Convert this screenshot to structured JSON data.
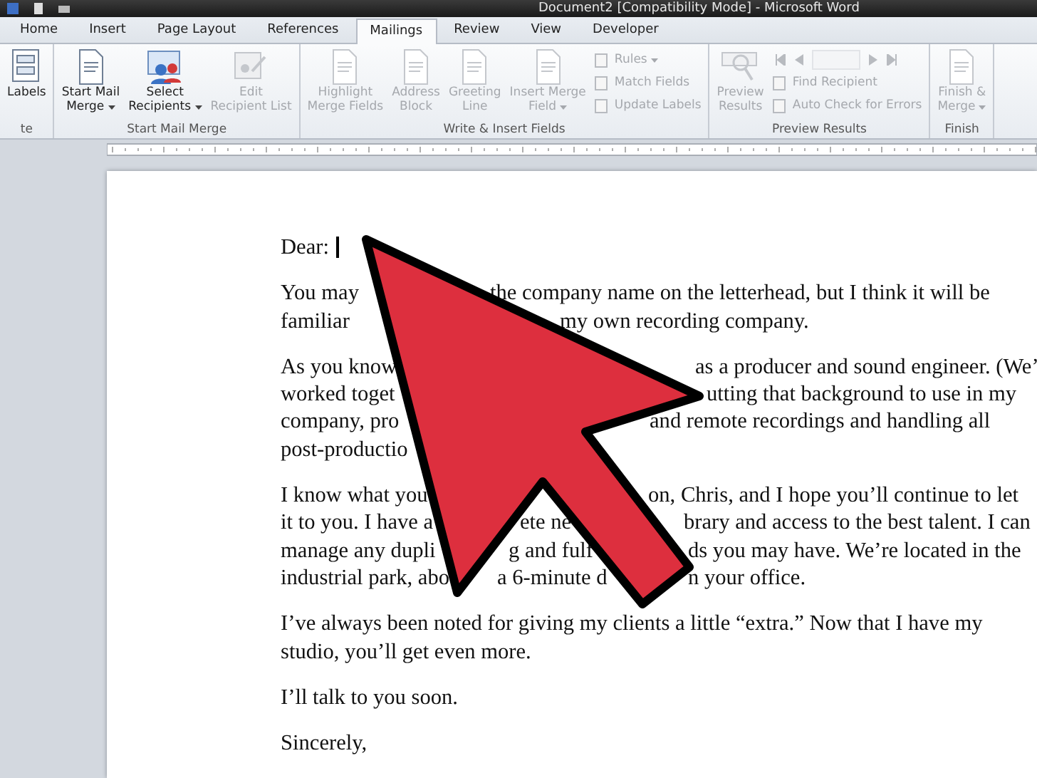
{
  "window": {
    "title": "Document2 [Compatibility Mode]  -  Microsoft Word"
  },
  "tabs": [
    {
      "label": "Home",
      "selected": false
    },
    {
      "label": "Insert",
      "selected": false
    },
    {
      "label": "Page Layout",
      "selected": false
    },
    {
      "label": "References",
      "selected": false
    },
    {
      "label": "Mailings",
      "selected": true
    },
    {
      "label": "Review",
      "selected": false
    },
    {
      "label": "View",
      "selected": false
    },
    {
      "label": "Developer",
      "selected": false
    }
  ],
  "ribbon": {
    "groups": [
      {
        "label": "te",
        "items": [
          {
            "kind": "large",
            "lines": [
              "Labels"
            ],
            "dropdown": false,
            "disabled": false
          }
        ]
      },
      {
        "label": "Start Mail Merge",
        "items": [
          {
            "kind": "large",
            "lines": [
              "Start Mail",
              "Merge"
            ],
            "dropdown": true,
            "disabled": false
          },
          {
            "kind": "large",
            "lines": [
              "Select",
              "Recipients"
            ],
            "dropdown": true,
            "disabled": false
          },
          {
            "kind": "large",
            "lines": [
              "Edit",
              "Recipient List"
            ],
            "dropdown": false,
            "disabled": true
          }
        ]
      },
      {
        "label": "Write & Insert Fields",
        "items": [
          {
            "kind": "large",
            "lines": [
              "Highlight",
              "Merge Fields"
            ],
            "dropdown": false,
            "disabled": true
          },
          {
            "kind": "large",
            "lines": [
              "Address",
              "Block"
            ],
            "dropdown": false,
            "disabled": true
          },
          {
            "kind": "large",
            "lines": [
              "Greeting",
              "Line"
            ],
            "dropdown": false,
            "disabled": true
          },
          {
            "kind": "large",
            "lines": [
              "Insert Merge",
              "Field"
            ],
            "dropdown": true,
            "disabled": true
          },
          {
            "kind": "stack",
            "items": [
              {
                "label": "Rules",
                "dropdown": true,
                "disabled": true
              },
              {
                "label": "Match Fields",
                "dropdown": false,
                "disabled": true
              },
              {
                "label": "Update Labels",
                "dropdown": false,
                "disabled": true
              }
            ]
          }
        ]
      },
      {
        "label": "Preview Results",
        "items": [
          {
            "kind": "large",
            "lines": [
              "Preview",
              "Results"
            ],
            "dropdown": false,
            "disabled": true
          },
          {
            "kind": "nav",
            "items": [
              {
                "label": "Find Recipient",
                "dropdown": false,
                "disabled": true
              },
              {
                "label": "Auto Check for Errors",
                "dropdown": false,
                "disabled": true
              }
            ]
          }
        ]
      },
      {
        "label": "Finish",
        "items": [
          {
            "kind": "large",
            "lines": [
              "Finish &",
              "Merge"
            ],
            "dropdown": true,
            "disabled": true
          }
        ]
      }
    ]
  },
  "document": {
    "paragraphs": [
      {
        "cursor": true,
        "lines": [
          [
            "Dear:"
          ]
        ]
      },
      {
        "cursor": false,
        "lines": [
          [
            "You may",
            "the company name on the letterhead, but I think it will be"
          ],
          [
            "familiar",
            "my own recording company."
          ]
        ]
      },
      {
        "cursor": false,
        "lines": [
          [
            "As you know",
            "as a producer and sound engineer. (We’"
          ],
          [
            "worked toget",
            "utting that background to use in my"
          ],
          [
            "company, pro",
            "and remote recordings and handling all"
          ],
          [
            "post-productio"
          ]
        ]
      },
      {
        "cursor": false,
        "lines": [
          [
            "I know what you",
            "on, Chris, and I hope you’ll continue to let"
          ],
          [
            "it to you. I have a",
            "ete ne",
            "brary and access to the best talent. I can"
          ],
          [
            "manage any dupli",
            "g and fulf",
            "ds you may have. We’re located in the"
          ],
          [
            "industrial park, abo",
            "a 6-minute d",
            "n your office."
          ]
        ]
      },
      {
        "cursor": false,
        "lines": [
          [
            "I’ve always been noted for giving my clients a little “extra.” Now that I have my"
          ],
          [
            "studio, you’ll get even more."
          ]
        ]
      },
      {
        "cursor": false,
        "lines": [
          [
            "I’ll talk to you soon."
          ]
        ]
      },
      {
        "cursor": false,
        "lines": [
          [
            "Sincerely,"
          ]
        ]
      }
    ]
  }
}
